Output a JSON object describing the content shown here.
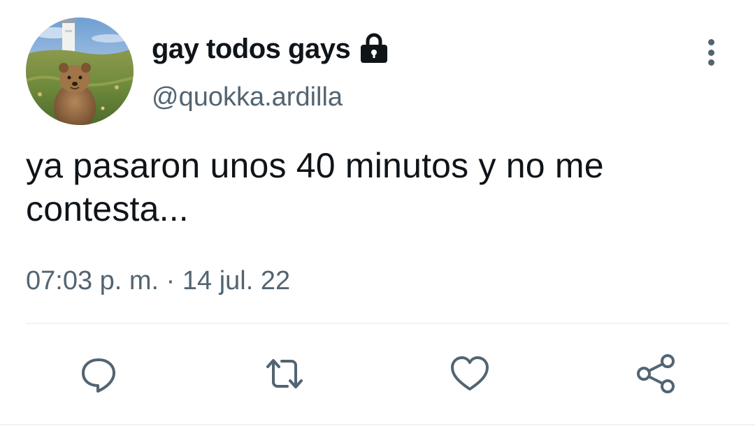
{
  "user": {
    "display_name": "gay todos gays",
    "handle": "@quokka.ardilla",
    "protected_icon": "lock-icon",
    "avatar": "quokka-lighthouse-photo"
  },
  "tweet": {
    "text": "ya pasaron unos 40 minutos y no me contesta...",
    "timestamp": "07:03 p. m. · 14 jul. 22"
  },
  "actions": [
    {
      "name": "reply",
      "icon": "reply-icon"
    },
    {
      "name": "retweet",
      "icon": "retweet-icon"
    },
    {
      "name": "like",
      "icon": "heart-icon"
    },
    {
      "name": "share",
      "icon": "share-icon"
    }
  ],
  "colors": {
    "text_primary": "#0f1419",
    "text_secondary": "#536471",
    "divider": "#eff3f4"
  }
}
